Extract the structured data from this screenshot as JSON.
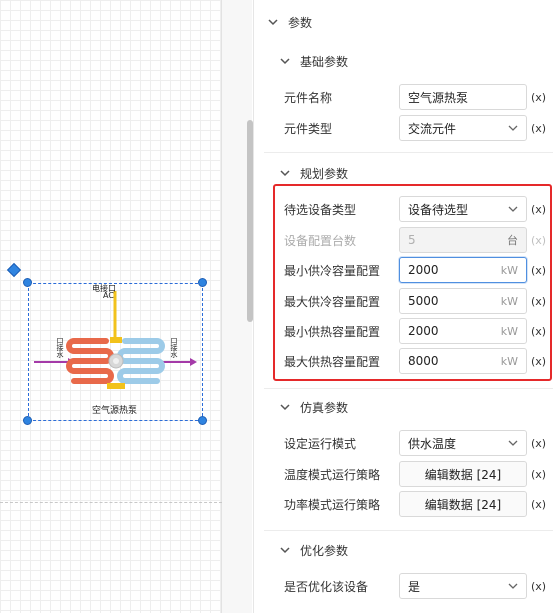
{
  "canvas": {
    "device": {
      "name": "空气源热泵",
      "port_top": "电接口",
      "port_top_sub": "AC",
      "port_left": "口接水",
      "port_right": "口接水",
      "colors": {
        "hot": "#e8694a",
        "cold": "#9dcbe8",
        "power": "#f2c21b",
        "flow": "#a43aa8",
        "selection": "#2f84e0"
      }
    }
  },
  "panel": {
    "root_title": "参数",
    "basic": {
      "title": "基础参数",
      "rows": [
        {
          "label": "元件名称",
          "value": "空气源热泵",
          "x": "(x)"
        },
        {
          "label": "元件类型",
          "value": "交流元件",
          "x": "(x)"
        }
      ]
    },
    "planning": {
      "title": "规划参数",
      "rows": [
        {
          "label": "待选设备类型",
          "value": "设备待选型",
          "x": "(x)"
        },
        {
          "label": "设备配置台数",
          "value": "5",
          "unit": "台",
          "x": "(x)"
        },
        {
          "label": "最小供冷容量配置",
          "value": "2000",
          "unit": "kW",
          "x": "(x)"
        },
        {
          "label": "最大供冷容量配置",
          "value": "5000",
          "unit": "kW",
          "x": "(x)"
        },
        {
          "label": "最小供热容量配置",
          "value": "2000",
          "unit": "kW",
          "x": "(x)"
        },
        {
          "label": "最大供热容量配置",
          "value": "8000",
          "unit": "kW",
          "x": "(x)"
        }
      ]
    },
    "simulation": {
      "title": "仿真参数",
      "rows": [
        {
          "label": "设定运行模式",
          "value": "供水温度",
          "x": "(x)"
        },
        {
          "label": "温度模式运行策略",
          "value": "编辑数据 [24]",
          "x": "(x)"
        },
        {
          "label": "功率模式运行策略",
          "value": "编辑数据 [24]",
          "x": "(x)"
        }
      ]
    },
    "optimization": {
      "title": "优化参数",
      "rows": [
        {
          "label": "是否优化该设备",
          "value": "是",
          "x": "(x)"
        }
      ]
    },
    "highlight_color": "#e5292a",
    "icons": [
      "chevron-down-icon",
      "select-chevron-icon"
    ]
  }
}
